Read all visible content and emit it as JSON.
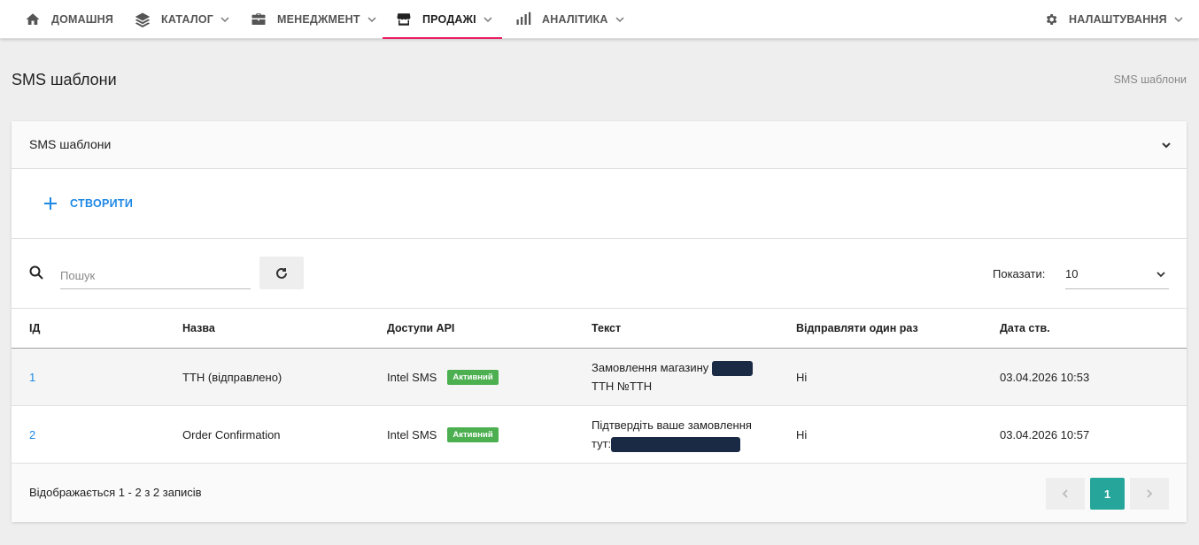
{
  "nav": {
    "home": "Домашня",
    "catalog": "Каталог",
    "management": "Менеджмент",
    "sales": "Продажі",
    "analytics": "Аналітика",
    "settings": "Налаштування"
  },
  "page": {
    "title": "SMS шаблони",
    "breadcrumb": "SMS шаблони"
  },
  "card": {
    "title": "SMS шаблони",
    "create_label": "СТВОРИТИ",
    "search_placeholder": "Пошук",
    "show_label": "Показати:",
    "show_value": "10"
  },
  "table": {
    "headers": {
      "id": "ІД",
      "name": "Назва",
      "api": "Доступи API",
      "text": "Текст",
      "once": "Відправляти один раз",
      "date": "Дата ств."
    },
    "rows": [
      {
        "id": "1",
        "name": "ТТН (відправлено)",
        "api": "Intel SMS",
        "status": "Активний",
        "text_a": "Замовлення магазину",
        "text_b": "ТТН №ТТН",
        "once": "Ні",
        "date": "03.04.2026 10:53"
      },
      {
        "id": "2",
        "name": "Order Confirmation",
        "api": "Intel SMS",
        "status": "Активний",
        "text_a": "Підтвердіть ваше замовлення",
        "text_b": "тут:",
        "once": "Ні",
        "date": "03.04.2026 10:57"
      }
    ]
  },
  "footer": {
    "info": "Відображається 1 - 2 з 2 записів",
    "current_page": "1"
  },
  "colors": {
    "accent": "#e91e63",
    "link": "#1e88e5",
    "badge": "#4caf50",
    "page_active": "#26a69a"
  }
}
